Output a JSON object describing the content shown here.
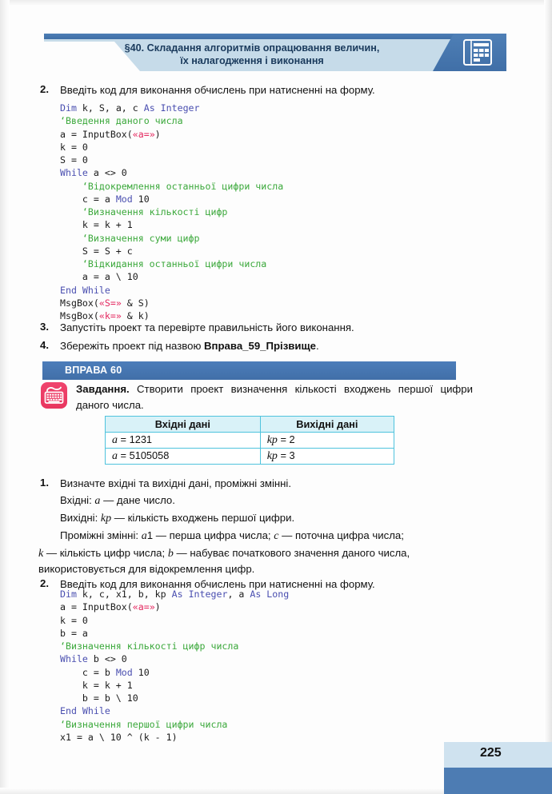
{
  "header": {
    "title_line1": "§40. Складання алгоритмів опрацювання величин,",
    "title_line2": "їх налагодження і виконання",
    "icon": "table-document-icon"
  },
  "items": {
    "n2_top": "2.",
    "t2_top": "Введіть код для виконання обчислень при натисненні на форму.",
    "n3": "3.",
    "t3": "Запустіть проект та перевірте правильність його виконання.",
    "n4": "4.",
    "t4_before": "Збережіть проект під назвою ",
    "t4_bold": "Вправа_59_Прізвище",
    "t4_after": ".",
    "n1_b": "1.",
    "t1_b": "Визначте вхідні та вихідні дані, проміжні змінні.",
    "n2_b": "2.",
    "t2_b": "Введіть код для виконання обчислень при натисненні на форму."
  },
  "code1": {
    "lines": [
      [
        {
          "t": "Dim",
          "c": "kw"
        },
        {
          "t": " k, S, a, c ",
          "c": ""
        },
        {
          "t": "As Integer",
          "c": "kw"
        }
      ],
      [
        {
          "t": "‘Введення даного числа",
          "c": "cm"
        }
      ],
      [
        {
          "t": "a = InputBox(",
          "c": ""
        },
        {
          "t": "«a=»",
          "c": "str"
        },
        {
          "t": ")",
          "c": ""
        }
      ],
      [
        {
          "t": "k = 0",
          "c": ""
        }
      ],
      [
        {
          "t": "S = 0",
          "c": ""
        }
      ],
      [
        {
          "t": "While",
          "c": "kw"
        },
        {
          "t": " a <> 0",
          "c": ""
        }
      ],
      [
        {
          "t": "    ‘Відокремлення останньої цифри числа",
          "c": "cm"
        }
      ],
      [
        {
          "t": "    c = a ",
          "c": ""
        },
        {
          "t": "Mod",
          "c": "kw"
        },
        {
          "t": " 10",
          "c": ""
        }
      ],
      [
        {
          "t": "    ‘Визначення кількості цифр",
          "c": "cm"
        }
      ],
      [
        {
          "t": "    k = k + 1",
          "c": ""
        }
      ],
      [
        {
          "t": "    ‘Визначення суми цифр",
          "c": "cm"
        }
      ],
      [
        {
          "t": "    S = S + c",
          "c": ""
        }
      ],
      [
        {
          "t": "    ‘Відкидання останньої цифри числа",
          "c": "cm"
        }
      ],
      [
        {
          "t": "    a = a \\ 10",
          "c": ""
        }
      ],
      [
        {
          "t": "End While",
          "c": "kw"
        }
      ],
      [
        {
          "t": "MsgBox(",
          "c": ""
        },
        {
          "t": "«S=»",
          "c": "str"
        },
        {
          "t": " & S)",
          "c": ""
        }
      ],
      [
        {
          "t": "MsgBox(",
          "c": ""
        },
        {
          "t": "«k=»",
          "c": "str"
        },
        {
          "t": " & k)",
          "c": ""
        }
      ]
    ]
  },
  "code2": {
    "lines": [
      [
        {
          "t": "Dim",
          "c": "kw"
        },
        {
          "t": " k, c, x1, b, kp ",
          "c": ""
        },
        {
          "t": "As Integer",
          "c": "kw"
        },
        {
          "t": ", a ",
          "c": ""
        },
        {
          "t": "As Long",
          "c": "kw"
        }
      ],
      [
        {
          "t": "a = InputBox(",
          "c": ""
        },
        {
          "t": "«a=»",
          "c": "str"
        },
        {
          "t": ")",
          "c": ""
        }
      ],
      [
        {
          "t": "k = 0",
          "c": ""
        }
      ],
      [
        {
          "t": "b = a",
          "c": ""
        }
      ],
      [
        {
          "t": "‘Визначення кількості цифр числа",
          "c": "cm"
        }
      ],
      [
        {
          "t": "While",
          "c": "kw"
        },
        {
          "t": " b <> 0",
          "c": ""
        }
      ],
      [
        {
          "t": "    c = b ",
          "c": ""
        },
        {
          "t": "Mod",
          "c": "kw"
        },
        {
          "t": " 10",
          "c": ""
        }
      ],
      [
        {
          "t": "    k = k + 1",
          "c": ""
        }
      ],
      [
        {
          "t": "    b = b \\ 10",
          "c": ""
        }
      ],
      [
        {
          "t": "End While",
          "c": "kw"
        }
      ],
      [
        {
          "t": "‘Визначення першої цифри числа",
          "c": "cm"
        }
      ],
      [
        {
          "t": "x1 = a \\ 10 ^ (k - 1)",
          "c": ""
        }
      ]
    ]
  },
  "exercise": {
    "banner_label": "ВПРАВА 60",
    "icon": "keyboard-icon",
    "task_bold": "Завдання.",
    "task_text": " Створити проект визначення кількості входжень першої цифри даного числа."
  },
  "table": {
    "headers": [
      "Вхідні дані",
      "Вихідні дані"
    ],
    "rows": [
      {
        "in_var": "a",
        "in_rest": " = 1231",
        "out_var": "kp",
        "out_rest": " = 2"
      },
      {
        "in_var": "a",
        "in_rest": " = 5105058",
        "out_var": "kp",
        "out_rest": " = 3"
      }
    ]
  },
  "definitions": {
    "line_in_label": "Вхідні: ",
    "line_in_var": "a",
    "line_in_rest": " — дане число.",
    "line_out_label": "Вихідні: ",
    "line_out_var": "kp",
    "line_out_rest": " — кількість входжень першої цифри.",
    "line_mid_label": "Проміжні змінні: ",
    "line_mid_var1": "a",
    "line_mid_seg1": "1 — перша цифра числа; ",
    "line_mid_var2": "c",
    "line_mid_seg2": " — поточна цифра числа;",
    "line_cont_var1": "k",
    "line_cont_seg1": " — кількість цифр числа; ",
    "line_cont_var2": "b",
    "line_cont_seg2": " — набуває початкового значення даного числа,",
    "line_cont2": "використовується для відокремлення цифр."
  },
  "footer": {
    "page_number": "225"
  },
  "colors": {
    "header_band": "#c6dbe9",
    "header_stripe": "#4d7eb5",
    "banner": "#4c7dba",
    "table_border": "#4fc3dd",
    "table_header_bg": "#d9f2f8",
    "icon_pink": "#f0456e",
    "code_keyword": "#4a4fb0",
    "code_comment": "#3aa83a",
    "code_string": "#e4285f",
    "footer_light": "#cfe2ef",
    "footer_dark": "#4d7cb3"
  }
}
